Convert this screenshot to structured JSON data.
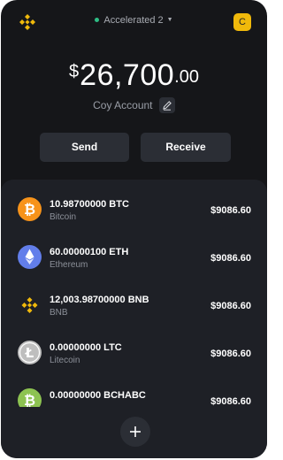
{
  "header": {
    "network_label": "Accelerated 2",
    "avatar_letter": "C",
    "status_color": "#2ebd85"
  },
  "balance": {
    "currency_symbol": "$",
    "whole": "26,700",
    "fraction": ".00"
  },
  "account": {
    "name": "Coy Account",
    "edit_icon": "pencil-icon"
  },
  "actions": {
    "send_label": "Send",
    "receive_label": "Receive"
  },
  "assets": [
    {
      "amount": "10.98700000 BTC",
      "name": "Bitcoin",
      "value": "$9086.60",
      "icon": "bitcoin-icon",
      "color": "#f7931a"
    },
    {
      "amount": "60.00000100 ETH",
      "name": "Ethereum",
      "value": "$9086.60",
      "icon": "ethereum-icon",
      "color": "#627eea"
    },
    {
      "amount": "12,003.98700000 BNB",
      "name": "BNB",
      "value": "$9086.60",
      "icon": "bnb-icon",
      "color": "#f0b90b"
    },
    {
      "amount": "0.00000000 LTC",
      "name": "Litecoin",
      "value": "$9086.60",
      "icon": "litecoin-icon",
      "color": "#bebebe"
    },
    {
      "amount": "0.00000000 BCHABC",
      "name": "",
      "value": "$9086.60",
      "icon": "bitcoin-cash-icon",
      "color": "#8dc351"
    }
  ],
  "add_icon": "plus-icon",
  "colors": {
    "background": "#151619",
    "panel": "#1e2026",
    "button": "#2b2e35",
    "accent": "#f0b90b"
  }
}
